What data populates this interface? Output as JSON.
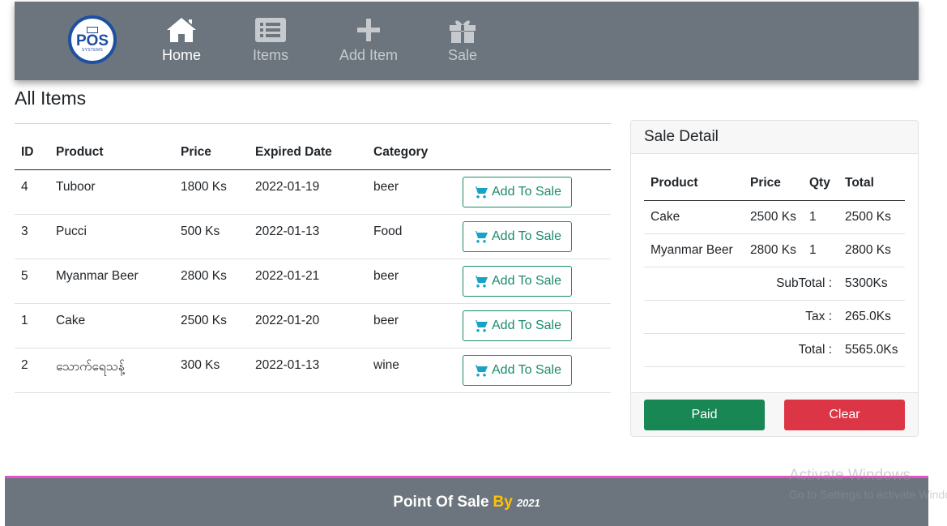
{
  "nav": {
    "logo": {
      "text": "POS",
      "subtext": "SYSTEMS"
    },
    "items": [
      {
        "label": "Home",
        "icon": "home-icon",
        "active": true
      },
      {
        "label": "Items",
        "icon": "list-icon",
        "active": false
      },
      {
        "label": "Add Item",
        "icon": "plus-icon",
        "active": false
      },
      {
        "label": "Sale",
        "icon": "gift-icon",
        "active": false
      }
    ]
  },
  "page": {
    "title": "All Items"
  },
  "items_table": {
    "headers": [
      "ID",
      "Product",
      "Price",
      "Expired Date",
      "Category"
    ],
    "add_button_label": "Add To Sale",
    "rows": [
      {
        "id": "4",
        "product": "Tuboor",
        "price": "1800 Ks",
        "expired": "2022-01-19",
        "category": "beer"
      },
      {
        "id": "3",
        "product": "Pucci",
        "price": "500 Ks",
        "expired": "2022-01-13",
        "category": "Food"
      },
      {
        "id": "5",
        "product": "Myanmar Beer",
        "price": "2800 Ks",
        "expired": "2022-01-21",
        "category": "beer"
      },
      {
        "id": "1",
        "product": "Cake",
        "price": "2500 Ks",
        "expired": "2022-01-20",
        "category": "beer"
      },
      {
        "id": "2",
        "product": "သောက်ရေသန့်",
        "price": "300 Ks",
        "expired": "2022-01-13",
        "category": "wine"
      }
    ]
  },
  "sale_detail": {
    "title": "Sale Detail",
    "headers": [
      "Product",
      "Price",
      "Qty",
      "Total"
    ],
    "rows": [
      {
        "product": "Cake",
        "price": "2500 Ks",
        "qty": "1",
        "total": "2500 Ks"
      },
      {
        "product": "Myanmar Beer",
        "price": "2800 Ks",
        "qty": "1",
        "total": "2800 Ks"
      }
    ],
    "subtotal_label": "SubTotal :",
    "subtotal_value": "5300Ks",
    "tax_label": "Tax :",
    "tax_value": "265.0Ks",
    "total_label": "Total :",
    "total_value": "5565.0Ks",
    "paid_label": "Paid",
    "clear_label": "Clear"
  },
  "footer": {
    "text": "Point Of Sale",
    "by": "By",
    "year": "2021"
  },
  "watermark": {
    "line1": "Activate Windows",
    "line2": "Go to Settings to activate Windows."
  },
  "colors": {
    "navbar": "#6c757d",
    "outline_success": "#1a8b6d",
    "paid": "#198754",
    "clear": "#dc3545",
    "footer_accent": "#ffc107",
    "footer_border": "#e352c6"
  }
}
